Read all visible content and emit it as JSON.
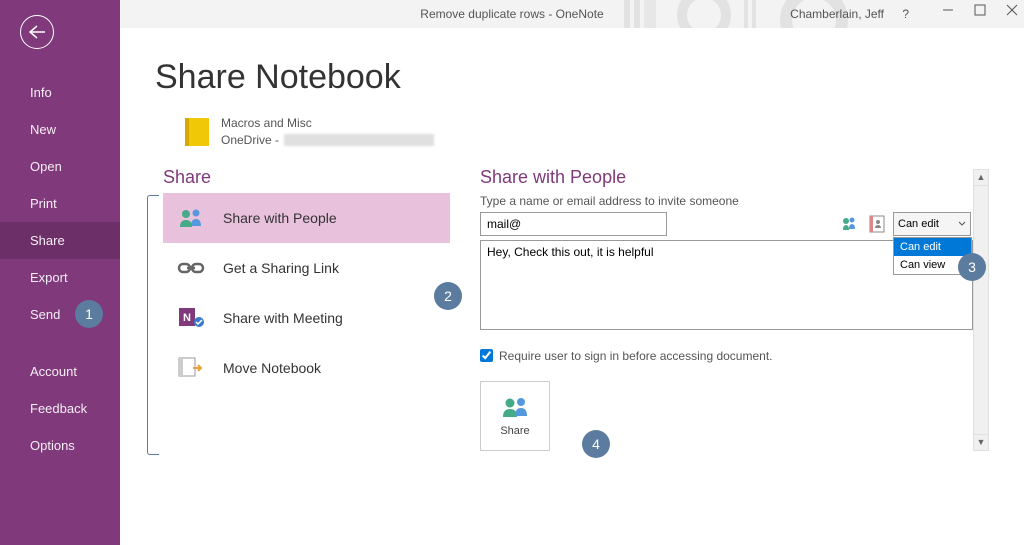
{
  "window": {
    "title": "Remove duplicate rows  -  OneNote",
    "user": "Chamberlain, Jeff",
    "help": "?"
  },
  "sidebar": {
    "items": [
      "Info",
      "New",
      "Open",
      "Print",
      "Share",
      "Export",
      "Send"
    ],
    "items2": [
      "Account",
      "Feedback",
      "Options"
    ],
    "activeIndex": 4
  },
  "page": {
    "title": "Share Notebook",
    "notebook": {
      "name": "Macros and Misc",
      "locationPrefix": "OneDrive -"
    }
  },
  "share": {
    "heading": "Share",
    "options": [
      {
        "label": "Share with People",
        "icon": "people"
      },
      {
        "label": "Get a Sharing Link",
        "icon": "link"
      },
      {
        "label": "Share with Meeting",
        "icon": "onenote-meeting"
      },
      {
        "label": "Move Notebook",
        "icon": "move-notebook"
      }
    ],
    "selectedIndex": 0
  },
  "panel": {
    "heading": "Share with People",
    "fieldLabel": "Type a name or email address to invite someone",
    "emailValue": "mail@",
    "permission": {
      "selected": "Can edit",
      "options": [
        "Can edit",
        "Can view"
      ]
    },
    "message": "Hey, Check this out, it is helpful",
    "requireSignin": "Require user to sign in before accessing document.",
    "requireChecked": true,
    "shareButton": "Share"
  },
  "callouts": [
    "1",
    "2",
    "3",
    "4"
  ]
}
